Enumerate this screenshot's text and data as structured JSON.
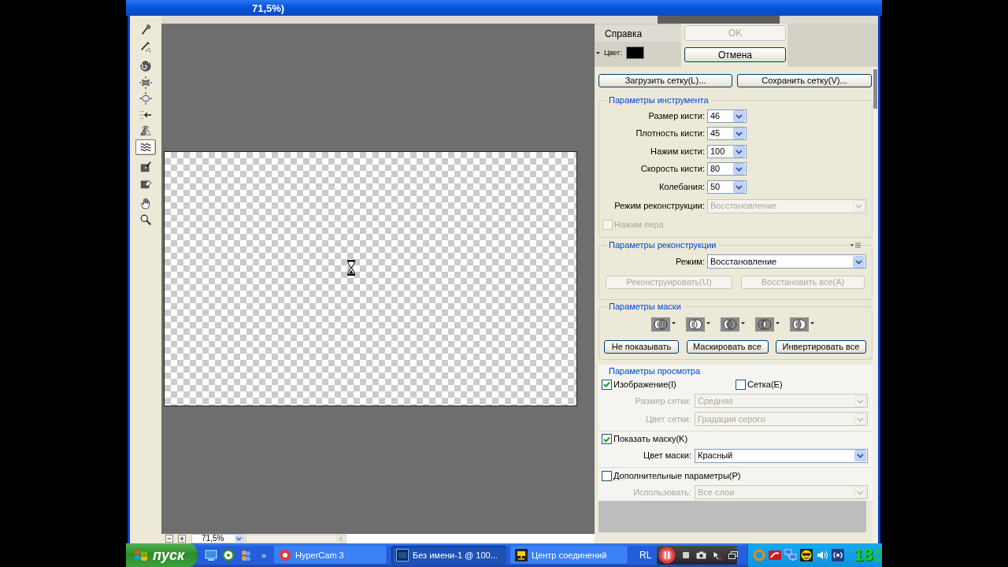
{
  "window": {
    "title": "71,5%)"
  },
  "tool_groups": [
    {
      "tools": [
        {
          "kind": "forward-warp",
          "selected": false
        },
        {
          "kind": "reconstruct",
          "selected": false
        }
      ]
    },
    {
      "tools": [
        {
          "kind": "twirl",
          "selected": false
        },
        {
          "kind": "pucker",
          "selected": false
        },
        {
          "kind": "bloat",
          "selected": false
        },
        {
          "kind": "push-left",
          "selected": false
        },
        {
          "kind": "mirror",
          "selected": false
        },
        {
          "kind": "turbulence",
          "selected": true
        }
      ]
    },
    {
      "tools": [
        {
          "kind": "freeze-mask",
          "selected": false
        },
        {
          "kind": "thaw-mask",
          "selected": false
        }
      ]
    },
    {
      "tools": [
        {
          "kind": "hand",
          "selected": false
        },
        {
          "kind": "zoom",
          "selected": false
        }
      ]
    }
  ],
  "zoom_field": {
    "value": "71,5%"
  },
  "panel": {
    "help_tab": "Справка",
    "color_label": "Цвет:",
    "ok_button": {
      "label": "OK",
      "disabled": true
    },
    "cancel_button": {
      "label": "Отмена",
      "disabled": false
    },
    "mesh_buttons": [
      {
        "label": "Загрузить сетку(L)..."
      },
      {
        "label": "Сохранить сетку(V)..."
      }
    ],
    "tool_options": {
      "title": "Параметры инструмента",
      "fields": [
        {
          "label": "Размер кисти:",
          "value": "46"
        },
        {
          "label": "Плотность кисти:",
          "value": "45"
        },
        {
          "label": "Нажим кисти:",
          "value": "100"
        },
        {
          "label": "Скорость кисти:",
          "value": "80"
        },
        {
          "label": "Колебания:",
          "value": "50"
        }
      ],
      "mode": {
        "label": "Режим реконструкции:",
        "value": "Восстановление",
        "disabled": true
      },
      "pen_pressure": {
        "label": "Нажим пера",
        "checked": false,
        "disabled": true
      }
    },
    "reconstruct_options": {
      "title": "Параметры реконструкции",
      "mode": {
        "label": "Режим:",
        "value": "Восстановление",
        "disabled": false
      },
      "buttons": [
        {
          "label": "Реконструировать(U)",
          "disabled": true
        },
        {
          "label": "Восстановить все(A)",
          "disabled": true
        }
      ]
    },
    "mask_options": {
      "title": "Параметры маски",
      "modes": [
        {
          "kind": "replace"
        },
        {
          "kind": "add"
        },
        {
          "kind": "subtract"
        },
        {
          "kind": "intersect"
        },
        {
          "kind": "invert"
        }
      ],
      "buttons": [
        {
          "label": "Не показывать"
        },
        {
          "label": "Маскировать все"
        },
        {
          "label": "Инвертировать все"
        }
      ]
    },
    "view_options": {
      "title": "Параметры просмотра",
      "image": {
        "label": "Изображение(I)",
        "checked": true
      },
      "mesh": {
        "label": "Сетка(E)",
        "checked": false
      },
      "mesh_size": {
        "label": "Размер сетки:",
        "value": "Средняя",
        "disabled": true
      },
      "mesh_color": {
        "label": "Цвет сетки:",
        "value": "Градации серого",
        "disabled": true
      },
      "show_mask": {
        "label": "Показать маску(K)",
        "checked": true
      },
      "mask_color": {
        "label": "Цвет маски:",
        "value": "Красный",
        "disabled": false
      },
      "advanced": {
        "label": "Дополнительные параметры(P)",
        "checked": false
      },
      "use": {
        "label": "Использовать:",
        "value": "Все слои",
        "disabled": true
      }
    }
  },
  "taskbar": {
    "start": "пуск",
    "quick_launch": [
      {
        "kind": "desktop"
      },
      {
        "kind": "ring"
      },
      {
        "kind": "people"
      }
    ],
    "overflow": "»",
    "tasks": [
      {
        "label": "HyperCam 3",
        "kind": "recorder",
        "selected": false
      },
      {
        "label": "Без имени-1 @ 100...",
        "kind": "editor",
        "selected": true
      },
      {
        "label": "Центр соединений",
        "kind": "network",
        "selected": false
      }
    ],
    "language": "RL",
    "recorder_controls": [
      {
        "kind": "pause"
      },
      {
        "kind": "stop"
      },
      {
        "kind": "camera"
      },
      {
        "kind": "cursor"
      },
      {
        "kind": "window"
      }
    ],
    "tray": [
      {
        "kind": "ring"
      },
      {
        "kind": "logo"
      },
      {
        "kind": "computers"
      },
      {
        "kind": "smiley"
      },
      {
        "kind": "speaker"
      },
      {
        "kind": "signal"
      }
    ],
    "clock": {
      "hours": "18",
      "minutes": "34",
      "seconds": "59"
    }
  }
}
